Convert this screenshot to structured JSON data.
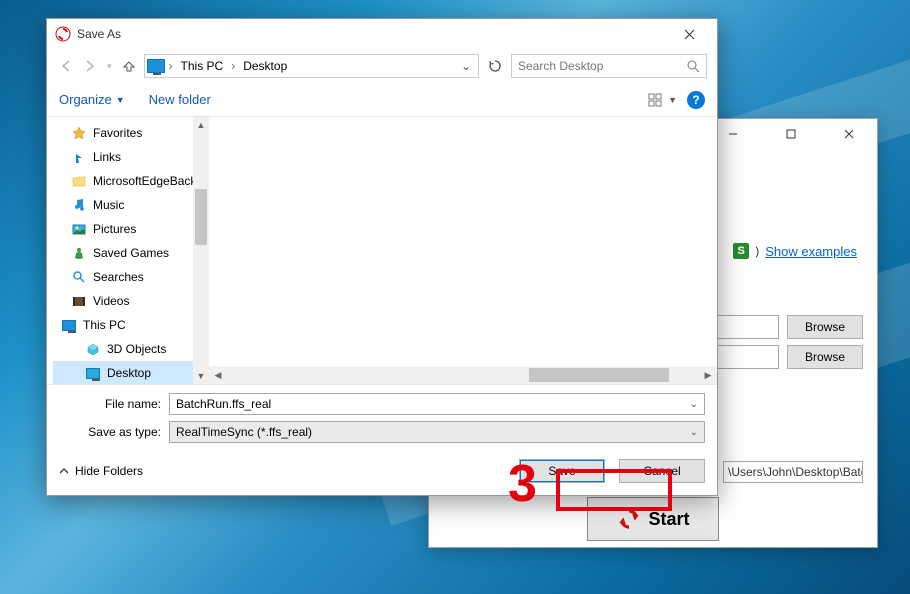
{
  "bgWindow": {
    "showExamples": "Show examples",
    "browse": "Browse",
    "path": "\\Users\\John\\Desktop\\Batch",
    "start": "Start"
  },
  "dialog": {
    "title": "Save As",
    "breadcrumb": {
      "root": "This PC",
      "leaf": "Desktop"
    },
    "search": {
      "placeholder": "Search Desktop"
    },
    "toolbar": {
      "organize": "Organize",
      "newFolder": "New folder"
    },
    "tree": {
      "items": [
        {
          "label": "Favorites",
          "icon": "star"
        },
        {
          "label": "Links",
          "icon": "links"
        },
        {
          "label": "MicrosoftEdgeBack",
          "icon": "folder"
        },
        {
          "label": "Music",
          "icon": "music"
        },
        {
          "label": "Pictures",
          "icon": "pictures"
        },
        {
          "label": "Saved Games",
          "icon": "games"
        },
        {
          "label": "Searches",
          "icon": "search"
        },
        {
          "label": "Videos",
          "icon": "videos"
        }
      ],
      "thisPC": "This PC",
      "sub": [
        {
          "label": "3D Objects",
          "icon": "3d"
        },
        {
          "label": "Desktop",
          "icon": "desktop",
          "selected": true
        }
      ]
    },
    "fields": {
      "fileNameLabel": "File name:",
      "fileNameValue": "BatchRun.ffs_real",
      "saveTypeLabel": "Save as type:",
      "saveTypeValue": "RealTimeSync (*.ffs_real)"
    },
    "footer": {
      "hideFolders": "Hide Folders",
      "save": "Save",
      "cancel": "Cancel"
    }
  },
  "annotation": {
    "step": "3"
  }
}
